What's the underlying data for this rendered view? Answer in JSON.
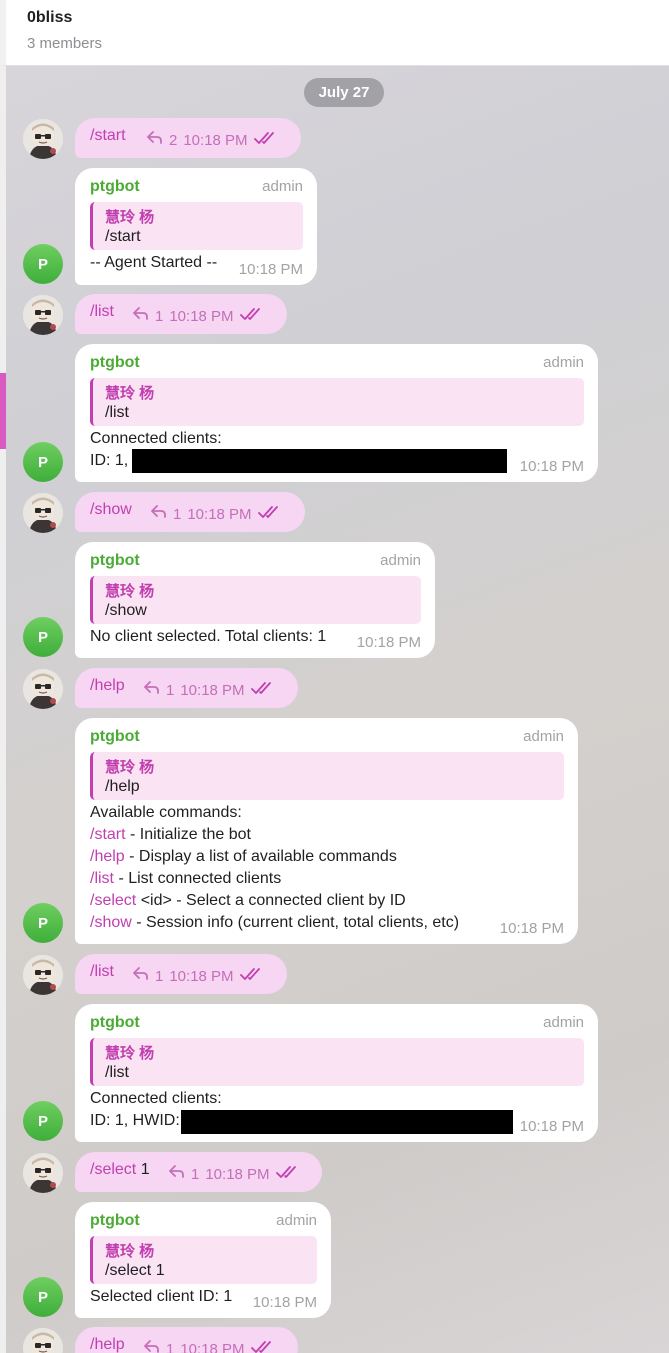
{
  "header": {
    "title": "0bliss",
    "members": "3 members"
  },
  "date": "July 27",
  "bot_avatar_letter": "P",
  "quote_author": "慧玲 杨",
  "messages": {
    "m1": {
      "cmd": "/start",
      "replies": "2",
      "time": "10:18 PM"
    },
    "m2": {
      "sender": "ptgbot",
      "role": "admin",
      "quote": "/start",
      "lines": [
        "-- Agent Started --"
      ],
      "time": "10:18 PM"
    },
    "m3": {
      "cmd": "/list",
      "replies": "1",
      "time": "10:18 PM"
    },
    "m4": {
      "sender": "ptgbot",
      "role": "admin",
      "quote": "/list",
      "lines": [
        "Connected clients:",
        "ID: 1,"
      ],
      "time": "10:18 PM"
    },
    "m5": {
      "cmd": "/show",
      "replies": "1",
      "time": "10:18 PM"
    },
    "m6": {
      "sender": "ptgbot",
      "role": "admin",
      "quote": "/show",
      "lines": [
        "No client selected. Total clients: 1"
      ],
      "time": "10:18 PM"
    },
    "m7": {
      "cmd": "/help",
      "replies": "1",
      "time": "10:18 PM"
    },
    "m8": {
      "sender": "ptgbot",
      "role": "admin",
      "quote": "/help",
      "intro": "Available commands:",
      "commands": [
        {
          "cmd": "/start",
          "desc": " - Initialize the bot"
        },
        {
          "cmd": "/help",
          "desc": " - Display a list of available commands"
        },
        {
          "cmd": "/list",
          "desc": " - List connected clients"
        },
        {
          "cmd": "/select",
          "desc": " <id> - Select a connected client by ID"
        },
        {
          "cmd": "/show",
          "desc": " - Session info (current client, total clients, etc)"
        }
      ],
      "time": "10:18 PM"
    },
    "m9": {
      "cmd": "/list",
      "replies": "1",
      "time": "10:18 PM"
    },
    "m10": {
      "sender": "ptgbot",
      "role": "admin",
      "quote": "/list",
      "lines": [
        "Connected clients:",
        "ID: 1, HWID:"
      ],
      "time": "10:18 PM"
    },
    "m11": {
      "cmd": "/select",
      "arg": " 1",
      "replies": "1",
      "time": "10:18 PM"
    },
    "m12": {
      "sender": "ptgbot",
      "role": "admin",
      "quote": "/select 1",
      "lines": [
        "Selected client ID: 1"
      ],
      "time": "10:18 PM"
    },
    "m13": {
      "cmd": "/help",
      "replies": "1",
      "time": "10:18 PM"
    }
  }
}
